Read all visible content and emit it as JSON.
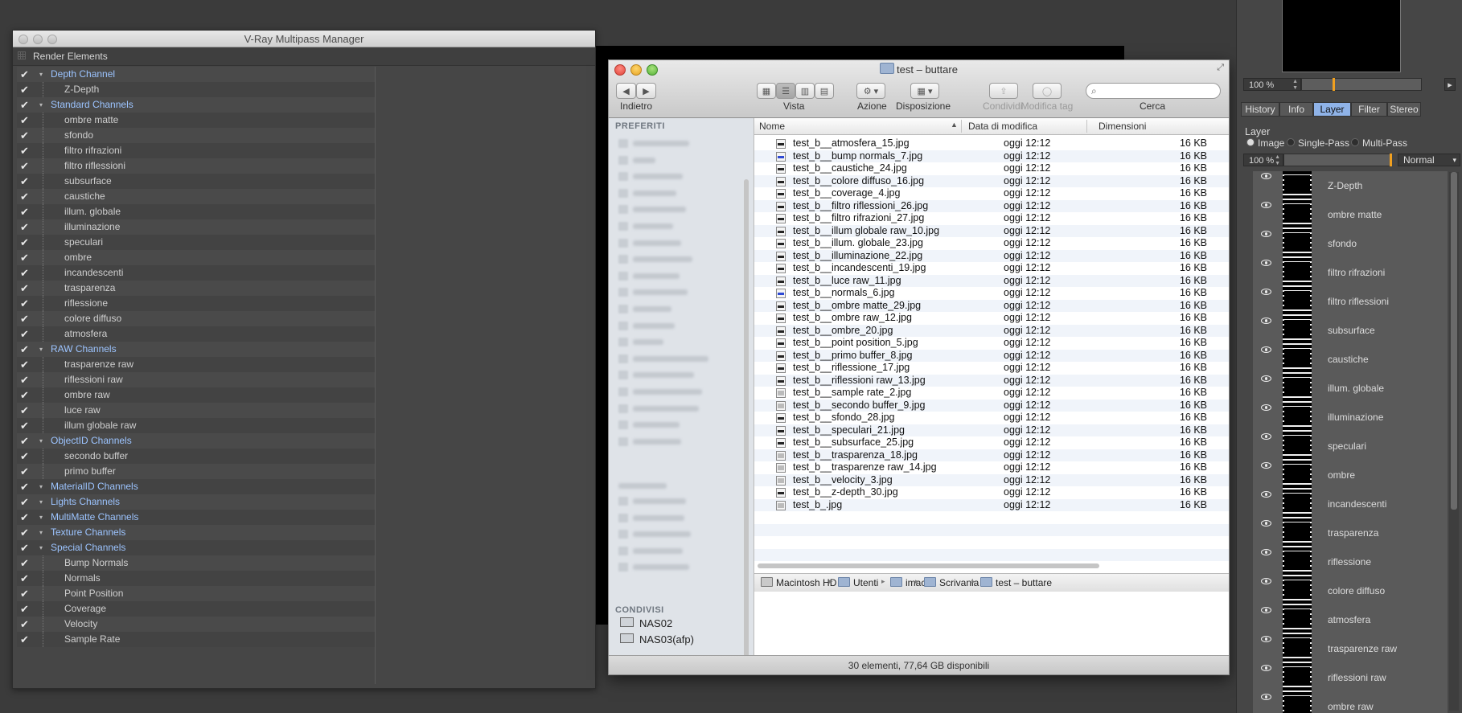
{
  "vray": {
    "title": "V-Ray Multipass Manager",
    "header": "Render Elements",
    "check": "✔",
    "tree": [
      {
        "label": "Depth Channel",
        "group": true
      },
      {
        "label": "Z-Depth",
        "group": false
      },
      {
        "label": "Standard Channels",
        "group": true
      },
      {
        "label": "ombre matte",
        "group": false
      },
      {
        "label": "sfondo",
        "group": false
      },
      {
        "label": "filtro rifrazioni",
        "group": false
      },
      {
        "label": "filtro riflessioni",
        "group": false
      },
      {
        "label": "subsurface",
        "group": false
      },
      {
        "label": "caustiche",
        "group": false
      },
      {
        "label": "illum. globale",
        "group": false
      },
      {
        "label": "illuminazione",
        "group": false
      },
      {
        "label": "speculari",
        "group": false
      },
      {
        "label": "ombre",
        "group": false
      },
      {
        "label": "incandescenti",
        "group": false
      },
      {
        "label": "trasparenza",
        "group": false
      },
      {
        "label": "riflessione",
        "group": false
      },
      {
        "label": "colore diffuso",
        "group": false
      },
      {
        "label": "atmosfera",
        "group": false
      },
      {
        "label": "RAW Channels",
        "group": true
      },
      {
        "label": "trasparenze raw",
        "group": false
      },
      {
        "label": "riflessioni raw",
        "group": false
      },
      {
        "label": "ombre raw",
        "group": false
      },
      {
        "label": "luce raw",
        "group": false
      },
      {
        "label": "illum globale raw",
        "group": false
      },
      {
        "label": "ObjectID Channels",
        "group": true
      },
      {
        "label": "secondo buffer",
        "group": false
      },
      {
        "label": "primo buffer",
        "group": false
      },
      {
        "label": "MaterialID Channels",
        "group": true
      },
      {
        "label": "Lights Channels",
        "group": true
      },
      {
        "label": "MultiMatte Channels",
        "group": true
      },
      {
        "label": "Texture Channels",
        "group": true
      },
      {
        "label": "Special Channels",
        "group": true
      },
      {
        "label": "Bump Normals",
        "group": false
      },
      {
        "label": "Normals",
        "group": false
      },
      {
        "label": "Point Position",
        "group": false
      },
      {
        "label": "Coverage",
        "group": false
      },
      {
        "label": "Velocity",
        "group": false
      },
      {
        "label": "Sample Rate",
        "group": false
      }
    ]
  },
  "finder": {
    "title": "test – buttare",
    "toolbar": {
      "back_label": "Indietro",
      "view_label": "Vista",
      "action_label": "Azione",
      "arrange_label": "Disposizione",
      "share_label": "Condividi",
      "tag_label": "Modifica tag",
      "search_label": "Cerca"
    },
    "sidebar": {
      "favorites_header": "PREFERITI",
      "shared_header": "CONDIVISI",
      "shared": [
        "NAS02",
        "NAS03(afp)"
      ]
    },
    "columns": {
      "name": "Nome",
      "date": "Data di modifica",
      "size": "Dimensioni"
    },
    "files": [
      {
        "name": "test_b__atmosfera_15.jpg",
        "date": "oggi 12:12",
        "size": "16 KB",
        "icon": "dark"
      },
      {
        "name": "test_b__bump normals_7.jpg",
        "date": "oggi 12:12",
        "size": "16 KB",
        "icon": "blue"
      },
      {
        "name": "test_b__caustiche_24.jpg",
        "date": "oggi 12:12",
        "size": "16 KB",
        "icon": "dark"
      },
      {
        "name": "test_b__colore diffuso_16.jpg",
        "date": "oggi 12:12",
        "size": "16 KB",
        "icon": "dark"
      },
      {
        "name": "test_b__coverage_4.jpg",
        "date": "oggi 12:12",
        "size": "16 KB",
        "icon": "dark"
      },
      {
        "name": "test_b__filtro riflessioni_26.jpg",
        "date": "oggi 12:12",
        "size": "16 KB",
        "icon": "dark"
      },
      {
        "name": "test_b__filtro rifrazioni_27.jpg",
        "date": "oggi 12:12",
        "size": "16 KB",
        "icon": "dark"
      },
      {
        "name": "test_b__illum globale raw_10.jpg",
        "date": "oggi 12:12",
        "size": "16 KB",
        "icon": "dark"
      },
      {
        "name": "test_b__illum. globale_23.jpg",
        "date": "oggi 12:12",
        "size": "16 KB",
        "icon": "dark"
      },
      {
        "name": "test_b__illuminazione_22.jpg",
        "date": "oggi 12:12",
        "size": "16 KB",
        "icon": "dark"
      },
      {
        "name": "test_b__incandescenti_19.jpg",
        "date": "oggi 12:12",
        "size": "16 KB",
        "icon": "dark"
      },
      {
        "name": "test_b__luce raw_11.jpg",
        "date": "oggi 12:12",
        "size": "16 KB",
        "icon": "dark"
      },
      {
        "name": "test_b__normals_6.jpg",
        "date": "oggi 12:12",
        "size": "16 KB",
        "icon": "blue"
      },
      {
        "name": "test_b__ombre matte_29.jpg",
        "date": "oggi 12:12",
        "size": "16 KB",
        "icon": "dark"
      },
      {
        "name": "test_b__ombre raw_12.jpg",
        "date": "oggi 12:12",
        "size": "16 KB",
        "icon": "dark"
      },
      {
        "name": "test_b__ombre_20.jpg",
        "date": "oggi 12:12",
        "size": "16 KB",
        "icon": "dark"
      },
      {
        "name": "test_b__point position_5.jpg",
        "date": "oggi 12:12",
        "size": "16 KB",
        "icon": "dark"
      },
      {
        "name": "test_b__primo buffer_8.jpg",
        "date": "oggi 12:12",
        "size": "16 KB",
        "icon": "dark"
      },
      {
        "name": "test_b__riflessione_17.jpg",
        "date": "oggi 12:12",
        "size": "16 KB",
        "icon": "dark"
      },
      {
        "name": "test_b__riflessioni raw_13.jpg",
        "date": "oggi 12:12",
        "size": "16 KB",
        "icon": "dark"
      },
      {
        "name": "test_b__sample rate_2.jpg",
        "date": "oggi 12:12",
        "size": "16 KB",
        "icon": "doc"
      },
      {
        "name": "test_b__secondo buffer_9.jpg",
        "date": "oggi 12:12",
        "size": "16 KB",
        "icon": "doc"
      },
      {
        "name": "test_b__sfondo_28.jpg",
        "date": "oggi 12:12",
        "size": "16 KB",
        "icon": "dark"
      },
      {
        "name": "test_b__speculari_21.jpg",
        "date": "oggi 12:12",
        "size": "16 KB",
        "icon": "dark"
      },
      {
        "name": "test_b__subsurface_25.jpg",
        "date": "oggi 12:12",
        "size": "16 KB",
        "icon": "dark"
      },
      {
        "name": "test_b__trasparenza_18.jpg",
        "date": "oggi 12:12",
        "size": "16 KB",
        "icon": "doc"
      },
      {
        "name": "test_b__trasparenze raw_14.jpg",
        "date": "oggi 12:12",
        "size": "16 KB",
        "icon": "doc"
      },
      {
        "name": "test_b__velocity_3.jpg",
        "date": "oggi 12:12",
        "size": "16 KB",
        "icon": "doc"
      },
      {
        "name": "test_b__z-depth_30.jpg",
        "date": "oggi 12:12",
        "size": "16 KB",
        "icon": "dark"
      },
      {
        "name": "test_b_.jpg",
        "date": "oggi 12:12",
        "size": "16 KB",
        "icon": "doc"
      }
    ],
    "path": [
      "Macintosh HD",
      "Utenti",
      "imac",
      "Scrivania",
      "test – buttare"
    ],
    "status": "30 elementi, 77,64 GB disponibili"
  },
  "panel": {
    "zoom_top": "100 %",
    "tabs": [
      "History",
      "Info",
      "Layer",
      "Filter",
      "Stereo"
    ],
    "active_tab": "Layer",
    "section_title": "Layer",
    "modes": [
      "Image",
      "Single-Pass",
      "Multi-Pass"
    ],
    "selected_mode": "Image",
    "opacity": "100 %",
    "blend_mode": "Normal",
    "layers": [
      "Z-Depth",
      "ombre matte",
      "sfondo",
      "filtro rifrazioni",
      "filtro riflessioni",
      "subsurface",
      "caustiche",
      "illum. globale",
      "illuminazione",
      "speculari",
      "ombre",
      "incandescenti",
      "trasparenza",
      "riflessione",
      "colore diffuso",
      "atmosfera",
      "trasparenze raw",
      "riflessioni raw",
      "ombre raw"
    ]
  }
}
